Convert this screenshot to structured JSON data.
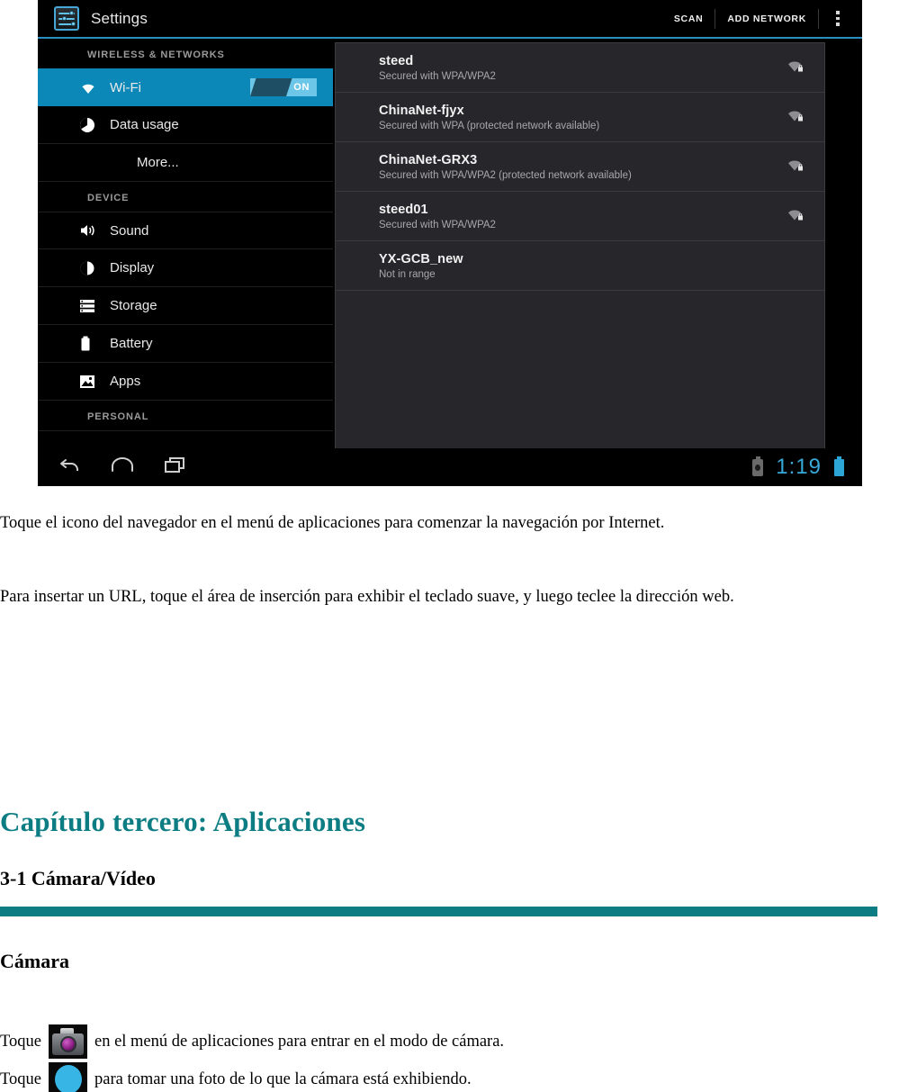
{
  "screenshot": {
    "action_bar": {
      "app_icon": "settings-sliders-icon",
      "title": "Settings",
      "buttons": [
        "SCAN",
        "ADD NETWORK"
      ],
      "overflow_icon": "overflow-menu-icon"
    },
    "sidebar": {
      "sections": [
        {
          "header": "WIRELESS & NETWORKS",
          "items": [
            {
              "label": "Wi-Fi",
              "icon": "wifi-icon",
              "active": true,
              "toggle": "ON"
            },
            {
              "label": "Data usage",
              "icon": "data-usage-icon",
              "active": false
            },
            {
              "label": "More...",
              "icon": "none",
              "active": false,
              "indent": true
            }
          ]
        },
        {
          "header": "DEVICE",
          "items": [
            {
              "label": "Sound",
              "icon": "speaker-icon",
              "active": false
            },
            {
              "label": "Display",
              "icon": "brightness-icon",
              "active": false
            },
            {
              "label": "Storage",
              "icon": "storage-icon",
              "active": false
            },
            {
              "label": "Battery",
              "icon": "battery-icon",
              "active": false
            },
            {
              "label": "Apps",
              "icon": "apps-image-icon",
              "active": false
            }
          ]
        },
        {
          "header": "PERSONAL",
          "items": []
        }
      ]
    },
    "wifi_networks": [
      {
        "name": "steed",
        "status": "Secured with WPA/WPA2",
        "signal_icon": "wifi-secured-icon",
        "has_icon": true
      },
      {
        "name": "ChinaNet-fjyx",
        "status": "Secured with WPA (protected network available)",
        "signal_icon": "wifi-secured-icon",
        "has_icon": true
      },
      {
        "name": "ChinaNet-GRX3",
        "status": "Secured with WPA/WPA2 (protected network available)",
        "signal_icon": "wifi-secured-icon",
        "has_icon": true
      },
      {
        "name": "steed01",
        "status": "Secured with WPA/WPA2",
        "signal_icon": "wifi-secured-icon",
        "has_icon": true
      },
      {
        "name": "YX-GCB_new",
        "status": "Not in range",
        "signal_icon": "none",
        "has_icon": false
      }
    ],
    "nav_bar": {
      "back_icon": "back-arrow-icon",
      "home_icon": "home-icon",
      "recents_icon": "recent-apps-icon",
      "usb_icon": "usb-storage-icon",
      "clock": "1:19",
      "battery_icon": "battery-icon"
    },
    "colors": {
      "accent_blue": "#2a8fc0",
      "highlight_blue": "#0c88b8",
      "clock_blue": "#36a9d8"
    }
  },
  "document": {
    "paragraph_1": "Toque el icono del navegador en el menú de  aplicaciones para comenzar la navegación por Internet.",
    "paragraph_2": "Para insertar un URL, toque el área de inserción para exhibir el teclado suave, y luego teclee la dirección web.",
    "chapter_title": "Capítulo tercero: Aplicaciones",
    "section_title": "3-1 Cámara/Vídeo",
    "subsection_title": "Cámara",
    "rule_color": "#0c7d83",
    "camera_line": {
      "prefix": "Toque",
      "icon": "camera-app-icon",
      "suffix": "en el menú de aplicaciones para entrar en el modo de cámara."
    },
    "shutter_line": {
      "prefix": "Toque",
      "icon": "shutter-button-icon",
      "suffix": "para tomar una foto de lo que la cámara está exhibiendo."
    }
  }
}
